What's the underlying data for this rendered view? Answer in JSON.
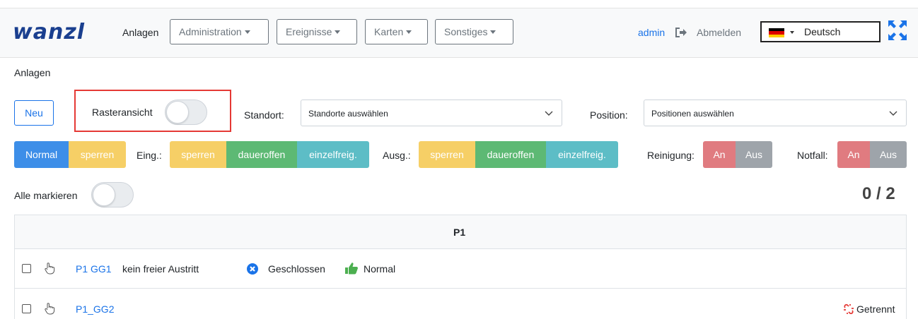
{
  "app": {
    "logo": "wanzl"
  },
  "nav": {
    "anlagen": "Anlagen",
    "menus": [
      "Administration",
      "Ereignisse",
      "Karten",
      "Sonstiges"
    ],
    "user": "admin",
    "logout": "Abmelden",
    "language": "Deutsch",
    "flag_colors": [
      "#000000",
      "#dd0000",
      "#ffce00"
    ]
  },
  "breadcrumb": "Anlagen",
  "toolbar": {
    "new_label": "Neu",
    "raster_label": "Rasteransicht",
    "raster_on": false,
    "standort_label": "Standort:",
    "standort_placeholder": "Standorte auswählen",
    "position_label": "Position:",
    "position_placeholder": "Positionen auswählen"
  },
  "modes": {
    "normal": "Normal",
    "sperren": "sperren",
    "eing_label": "Eing.:",
    "eing": [
      "sperren",
      "daueroffen",
      "einzelfreig."
    ],
    "ausg_label": "Ausg.:",
    "ausg": [
      "sperren",
      "daueroffen",
      "einzelfreig."
    ],
    "reinigung_label": "Reinigung:",
    "reinigung": [
      "An",
      "Aus"
    ],
    "notfall_label": "Notfall:",
    "notfall": [
      "An",
      "Aus"
    ]
  },
  "select_all": {
    "label": "Alle markieren",
    "checked": false
  },
  "counter": "0 / 2",
  "table": {
    "group_header": "P1",
    "rows": [
      {
        "name": "P1 GG1",
        "info": "kein freier Austritt",
        "door_status": "Geschlossen",
        "mode_status": "Normal",
        "connection": ""
      },
      {
        "name": "P1_GG2",
        "info": "",
        "door_status": "",
        "mode_status": "",
        "connection": "Getrennt"
      }
    ]
  },
  "colors": {
    "primary": "#1a73e8",
    "logo": "#1a3f8f",
    "yellow": "#f6cf66",
    "green": "#5db974",
    "teal": "#5dbdc6",
    "red": "#e07b80",
    "gray": "#9ea4aa",
    "highlight_box": "#e53935"
  }
}
